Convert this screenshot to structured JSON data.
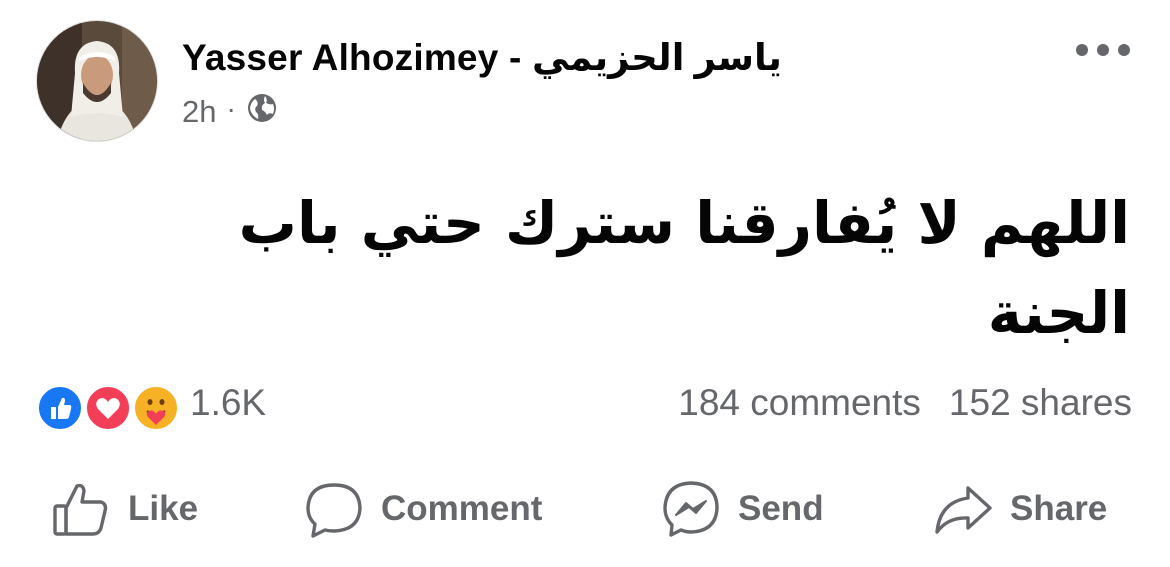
{
  "post": {
    "author": "Yasser Alhozimey - ياسر الحزيمي",
    "time": "2h",
    "separator": "·",
    "privacy_icon": "globe-icon",
    "menu_icon": "more-options-icon",
    "text": "اللهم لا يُفارقنا سترك حتي باب الجنة"
  },
  "reactions": {
    "icons": [
      "like-reaction-icon",
      "love-reaction-icon",
      "care-reaction-icon"
    ],
    "count": "1.6K"
  },
  "stats": {
    "comments": "184 comments",
    "shares": "152 shares"
  },
  "actions": {
    "like": "Like",
    "comment": "Comment",
    "send": "Send",
    "share": "Share"
  },
  "colors": {
    "text": "#050505",
    "secondary": "#65676b",
    "like_blue": "#1877f2",
    "love_red": "#f33e58",
    "care_yellow": "#f7b125"
  }
}
